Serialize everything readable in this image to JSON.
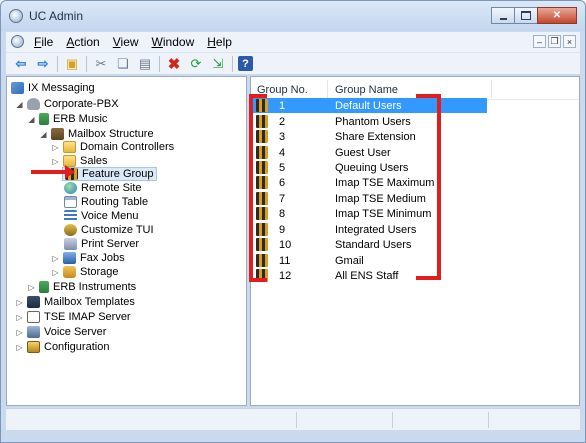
{
  "window": {
    "title": "UC Admin"
  },
  "menu": {
    "items": [
      "File",
      "Action",
      "View",
      "Window",
      "Help"
    ]
  },
  "toolbar": {
    "icons": [
      "back-arrow-icon",
      "forward-arrow-icon",
      "up-folder-icon",
      "cut-icon",
      "copy-icon",
      "paste-icon",
      "delete-icon",
      "refresh-icon",
      "export-icon",
      "help-icon"
    ]
  },
  "tree": {
    "items": [
      {
        "label": "IX Messaging",
        "icon": "ix-messaging-icon"
      },
      {
        "label": "Corporate-PBX",
        "icon": "pbx-icon"
      },
      {
        "label": "ERB Music",
        "icon": "erb-music-icon"
      },
      {
        "label": "Mailbox Structure",
        "icon": "mailbox-structure-icon"
      },
      {
        "label": "Domain Controllers",
        "icon": "folder-icon"
      },
      {
        "label": "Sales",
        "icon": "folder-icon"
      },
      {
        "label": "Feature Group",
        "icon": "feature-group-icon",
        "selected": true
      },
      {
        "label": "Remote Site",
        "icon": "globe-icon"
      },
      {
        "label": "Routing Table",
        "icon": "table-icon"
      },
      {
        "label": "Voice Menu",
        "icon": "voice-menu-icon"
      },
      {
        "label": "Customize TUI",
        "icon": "customize-tui-icon"
      },
      {
        "label": "Print Server",
        "icon": "print-server-icon"
      },
      {
        "label": "Fax Jobs",
        "icon": "fax-jobs-icon"
      },
      {
        "label": "Storage",
        "icon": "storage-icon"
      },
      {
        "label": "ERB Instruments",
        "icon": "erb-instruments-icon"
      },
      {
        "label": "Mailbox Templates",
        "icon": "mailbox-templates-icon"
      },
      {
        "label": "TSE IMAP Server",
        "icon": "imap-server-icon"
      },
      {
        "label": "Voice Server",
        "icon": "voice-server-icon"
      },
      {
        "label": "Configuration",
        "icon": "configuration-icon"
      }
    ]
  },
  "list": {
    "columns": [
      "Group No.",
      "Group Name"
    ],
    "rows": [
      {
        "no": "1",
        "name": "Default Users",
        "selected": true
      },
      {
        "no": "2",
        "name": "Phantom Users"
      },
      {
        "no": "3",
        "name": "Share Extension"
      },
      {
        "no": "4",
        "name": "Guest User"
      },
      {
        "no": "5",
        "name": "Queuing Users"
      },
      {
        "no": "6",
        "name": "Imap TSE Maximum"
      },
      {
        "no": "7",
        "name": "Imap TSE Medium"
      },
      {
        "no": "8",
        "name": "Imap TSE Minimum"
      },
      {
        "no": "9",
        "name": "Integrated Users"
      },
      {
        "no": "10",
        "name": "Standard Users"
      },
      {
        "no": "11",
        "name": "Gmail"
      },
      {
        "no": "12",
        "name": "All ENS Staff"
      }
    ]
  },
  "annotations": {
    "color": "#e21d1d"
  }
}
